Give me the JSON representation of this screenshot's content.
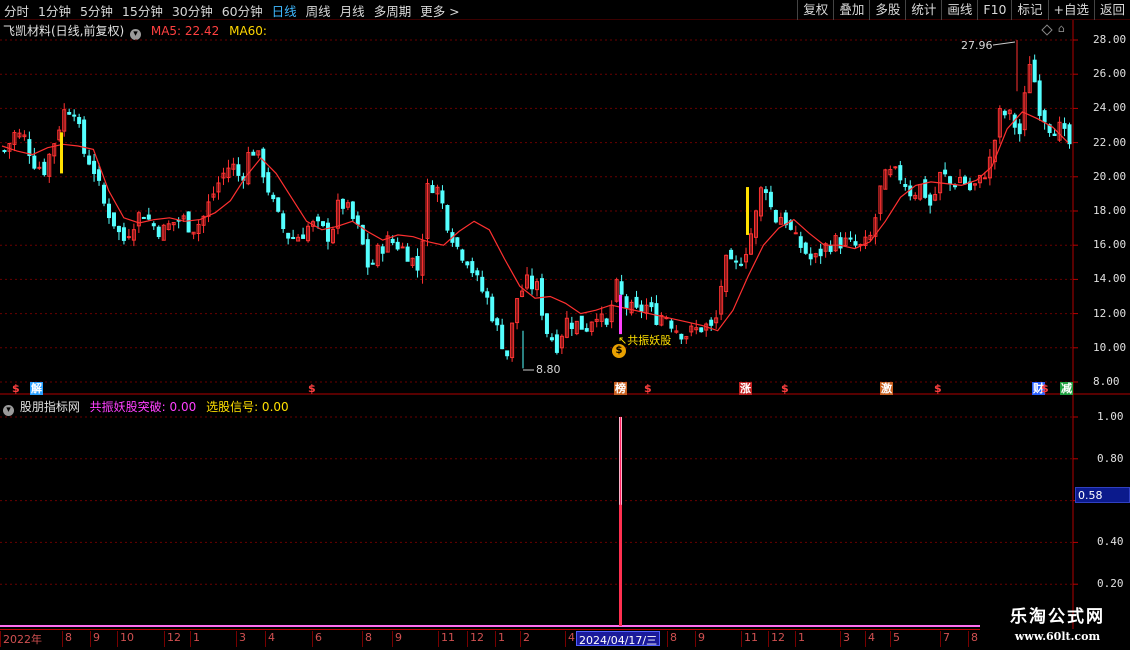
{
  "toolbar": {
    "periods": [
      "分时",
      "1分钟",
      "5分钟",
      "15分钟",
      "30分钟",
      "60分钟",
      "日线",
      "周线",
      "月线",
      "多周期",
      "更多 >"
    ],
    "active_index": 6,
    "actions": [
      "复权",
      "叠加",
      "多股",
      "统计",
      "画线",
      "F10",
      "标记",
      "+自选",
      "返回"
    ]
  },
  "main_header": {
    "stock_name": "飞凯材料(日线,前复权)",
    "ma5_label": "MA5: 22.42",
    "ma60_label": "MA60:"
  },
  "sub_header": {
    "indicator_name": "股朋指标网",
    "signal_label": "共振妖股突破: 0.00",
    "select_label": "选股信号: 0.00"
  },
  "price_axis": [
    "28.00",
    "26.00",
    "24.00",
    "22.00",
    "20.00",
    "18.00",
    "16.00",
    "14.00",
    "12.00",
    "10.00",
    "8.00"
  ],
  "indicator_axis": [
    "1.00",
    "0.80",
    "0.40",
    "0.20"
  ],
  "indicator_current": "0.58",
  "annotations": {
    "high": "27.96",
    "low": "8.80",
    "signal": "共振妖股"
  },
  "events": [
    {
      "label": "$",
      "color": "#ff4040",
      "kind": "dollar"
    },
    {
      "label": "解",
      "color": "#2aa0ff",
      "kind": "box"
    },
    {
      "label": "$",
      "color": "#ff4040",
      "kind": "dollar"
    },
    {
      "label": "榜",
      "color": "#c86020",
      "kind": "box"
    },
    {
      "label": "$",
      "color": "#ff4040",
      "kind": "dollar"
    },
    {
      "label": "涨",
      "color": "#c02020",
      "kind": "box"
    },
    {
      "label": "$",
      "color": "#ff4040",
      "kind": "dollar"
    },
    {
      "label": "激",
      "color": "#c86020",
      "kind": "box"
    },
    {
      "label": "$",
      "color": "#ff4040",
      "kind": "dollar"
    },
    {
      "label": "财",
      "color": "#2a60ff",
      "kind": "box"
    },
    {
      "label": "$",
      "color": "#ff4040",
      "kind": "dollar"
    },
    {
      "label": "减",
      "color": "#20a040",
      "kind": "box"
    }
  ],
  "date_axis": [
    "2022年",
    "8",
    "9",
    "10",
    "12",
    "1",
    "3",
    "4",
    "6",
    "8",
    "9",
    "11",
    "12",
    "1",
    "2",
    "4",
    "6",
    "8",
    "9",
    "11",
    "12",
    "1",
    "3",
    "4",
    "5",
    "7",
    "8"
  ],
  "date_highlight": "2024/04/17/三",
  "colors": {
    "up": "#ff3232",
    "down": "#54ffff",
    "ma5": "#ff4040",
    "ma60": "#ffd700",
    "grid": "#7a0000",
    "signal_magenta": "#ff40ff",
    "signal_yellow": "#ffe000"
  },
  "chart_data": {
    "type": "candlestick",
    "ylim": [
      8.0,
      28.3
    ],
    "indicator_ylim": [
      0.0,
      1.05
    ],
    "extreme_high": 27.96,
    "extreme_low": 8.8,
    "indicator_spike": 1.0,
    "indicator_spike_secondary": 0.58,
    "ma_line_points": [
      21.8,
      21.5,
      21.3,
      21.7,
      21.9,
      21.8,
      21.6,
      19.2,
      17.6,
      17.3,
      17.5,
      17.6,
      17.4,
      17.5,
      17.9,
      18.6,
      20.0,
      21.1,
      20.2,
      18.8,
      17.4,
      16.9,
      17.1,
      17.4,
      16.8,
      16.3,
      16.6,
      16.5,
      16.2,
      16.0,
      16.8,
      17.4,
      16.9,
      15.2,
      13.6,
      12.9,
      13.0,
      12.6,
      12.0,
      12.2,
      12.5,
      12.3,
      12.1,
      11.9,
      11.7,
      11.5,
      11.3,
      11.0,
      12.2,
      14.2,
      16.0,
      17.0,
      17.5,
      16.7,
      16.0,
      16.0,
      15.8,
      16.2,
      17.4,
      18.8,
      19.5,
      19.7,
      19.6,
      19.5,
      19.8,
      20.6,
      22.8,
      23.8,
      23.4,
      22.9,
      22.0
    ],
    "close_series": [
      21.5,
      22.5,
      22.3,
      20.9,
      20.4,
      22.0,
      23.8,
      24.2,
      21.5,
      20.6,
      18.5,
      17.5,
      16.2,
      17.3,
      18.0,
      17.2,
      16.8,
      17.3,
      17.6,
      17.0,
      17.4,
      18.8,
      20.0,
      20.8,
      19.8,
      21.8,
      20.8,
      18.8,
      17.2,
      16.4,
      16.6,
      17.2,
      17.0,
      16.5,
      18.6,
      17.9,
      16.7,
      14.5,
      15.8,
      16.3,
      16.0,
      15.5,
      14.5,
      19.8,
      19.2,
      17.2,
      15.8,
      15.2,
      13.8,
      12.8,
      11.0,
      9.6,
      13.0,
      13.8,
      13.5,
      11.0,
      10.2,
      11.6,
      11.4,
      11.2,
      12.2,
      11.0,
      13.6,
      12.5,
      12.0,
      12.5,
      11.8,
      12.0,
      11.2,
      10.8,
      11.0,
      11.3,
      11.0,
      15.0,
      14.6,
      15.5,
      17.2,
      20.0,
      17.5,
      17.8,
      16.4,
      15.8,
      15.0,
      15.8,
      16.2,
      16.2,
      16.0,
      15.8,
      16.6,
      19.8,
      20.2,
      20.0,
      19.0,
      19.5,
      18.2,
      20.3,
      19.5,
      20.0,
      19.2,
      19.8,
      21.0,
      23.8,
      23.5,
      22.5,
      27.0,
      24.0,
      23.0,
      22.8,
      21.9
    ]
  }
}
